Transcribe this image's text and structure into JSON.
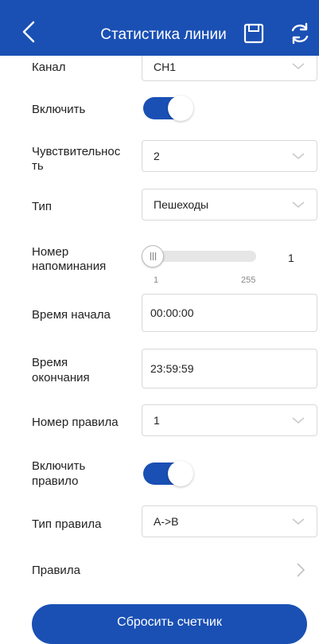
{
  "header": {
    "title": "Статистика линии",
    "back_icon": "chevron-left-icon",
    "save_icon": "save-icon",
    "refresh_icon": "refresh-icon",
    "background": "#1a50b4"
  },
  "form": {
    "channel": {
      "label": "Канал",
      "value": "CH1"
    },
    "enable": {
      "label": "Включить",
      "on": true
    },
    "sensitivity": {
      "label_line1": "Чувствительнос",
      "label_line2": "ть",
      "value": "2"
    },
    "type": {
      "label": "Тип",
      "value": "Пешеходы"
    },
    "reminder_number": {
      "label_line1": "Номер",
      "label_line2": "напоминания",
      "value": "1",
      "min": "1",
      "max": "255"
    },
    "start_time": {
      "label": "Время начала",
      "value": "00:00:00"
    },
    "end_time": {
      "label_line1": "Время",
      "label_line2": "окончания",
      "value": "23:59:59"
    },
    "rule_number": {
      "label": "Номер правила",
      "value": "1"
    },
    "enable_rule": {
      "label_line1": "Включить",
      "label_line2": "правило",
      "on": true
    },
    "rule_type": {
      "label": "Тип правила",
      "value": "A->B"
    },
    "rules": {
      "label": "Правила"
    }
  },
  "footer": {
    "reset_label": "Сбросить счетчик"
  },
  "colors": {
    "accent": "#1a50b4",
    "border": "#d8d8d8",
    "muted": "#888888"
  }
}
